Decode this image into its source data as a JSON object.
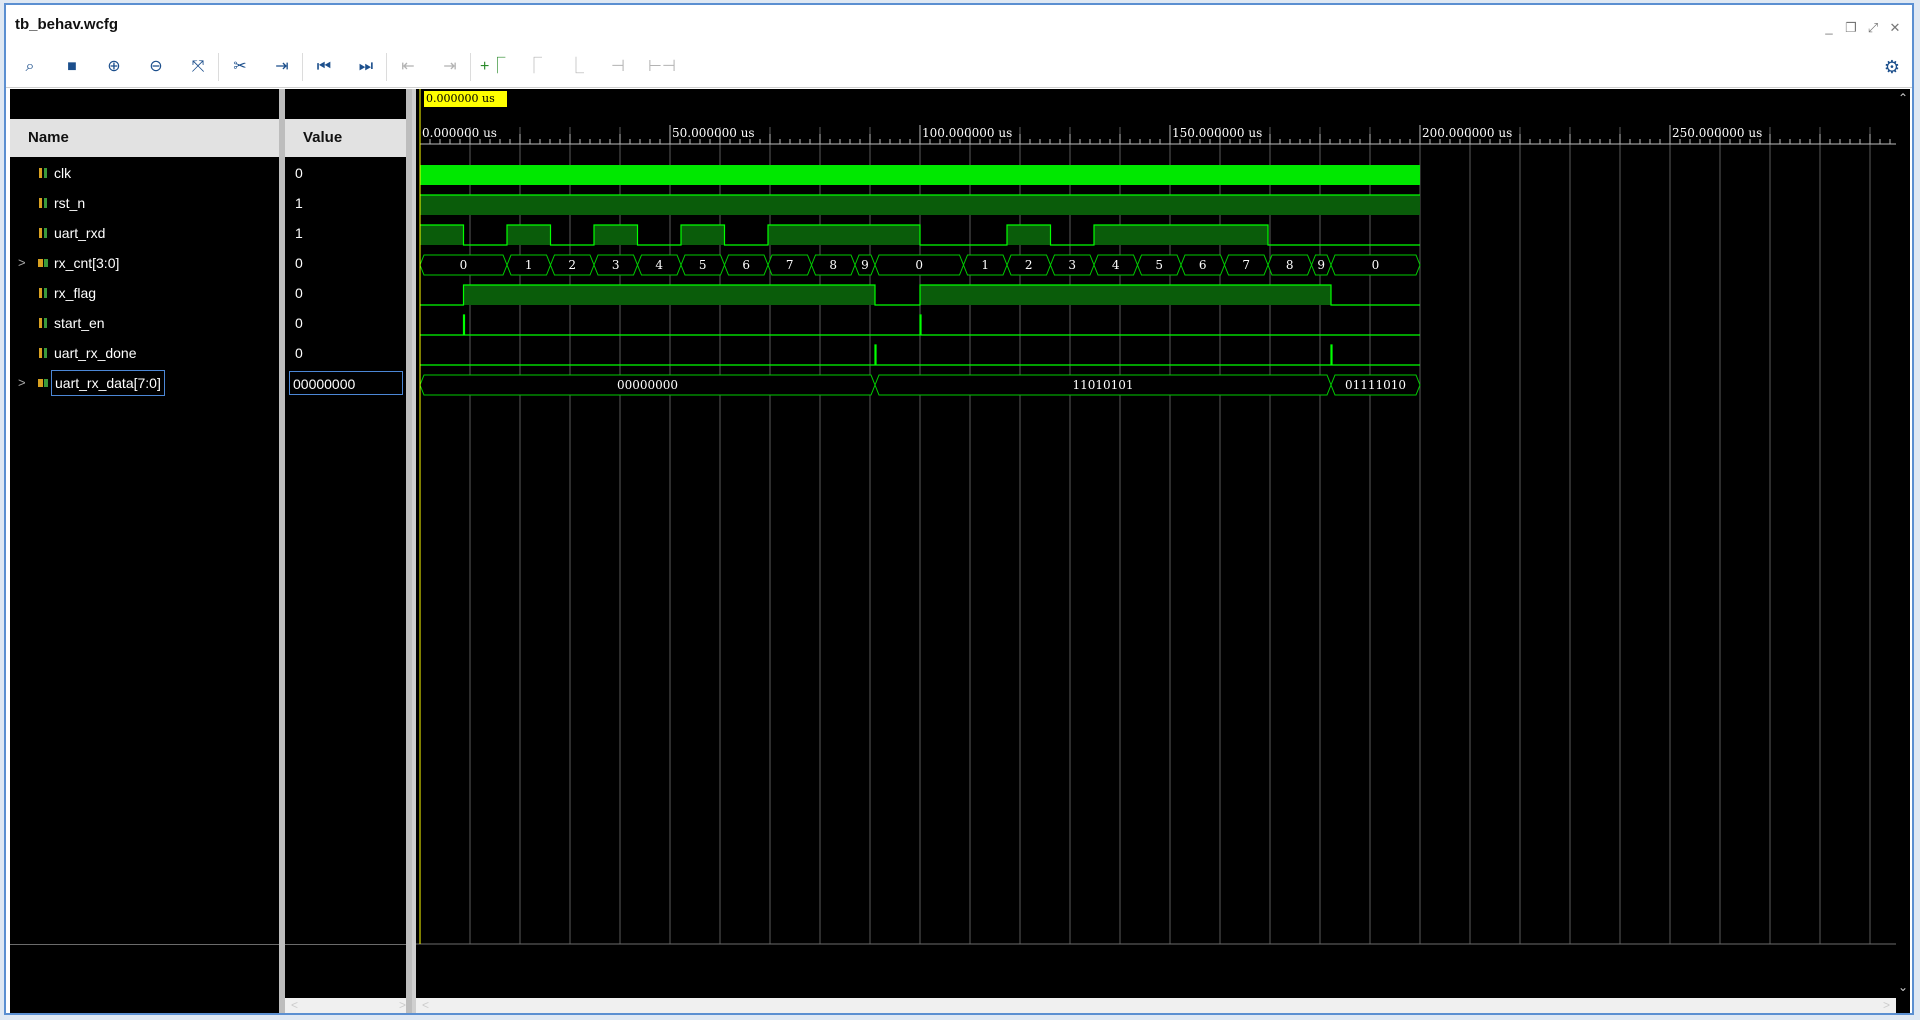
{
  "window": {
    "title": "tb_behav.wcfg",
    "controls": [
      "minimize-icon",
      "restore-icon",
      "float-icon",
      "close-icon"
    ]
  },
  "toolbar": {
    "buttons": [
      {
        "name": "search",
        "icon": "search-icon",
        "enabled": true
      },
      {
        "name": "save",
        "icon": "save-icon",
        "enabled": true
      },
      {
        "name": "zoom-in",
        "icon": "zoom-in-icon",
        "enabled": true
      },
      {
        "name": "zoom-out",
        "icon": "zoom-out-icon",
        "enabled": true
      },
      {
        "name": "zoom-fit",
        "icon": "zoom-fit-icon",
        "enabled": true
      },
      {
        "name": "go-to-cursor",
        "icon": "go-to-cursor-icon",
        "enabled": true
      },
      {
        "name": "add-marker",
        "icon": "add-marker-icon",
        "enabled": true
      },
      {
        "name": "go-to-time-zero",
        "icon": "go-to-start-icon",
        "enabled": true
      },
      {
        "name": "go-to-last-time",
        "icon": "go-to-end-icon",
        "enabled": true
      },
      {
        "name": "previous-transition",
        "icon": "previous-transition-icon",
        "enabled": false
      },
      {
        "name": "next-transition",
        "icon": "next-transition-icon",
        "enabled": false
      },
      {
        "name": "add-marker-2",
        "icon": "add-marker-icon",
        "enabled": true
      },
      {
        "name": "previous-marker",
        "icon": "previous-marker-icon",
        "enabled": false
      },
      {
        "name": "next-marker",
        "icon": "next-marker-icon",
        "enabled": false
      },
      {
        "name": "swap-cursors",
        "icon": "swap-cursors-icon",
        "enabled": false
      },
      {
        "name": "snap-to-transition",
        "icon": "snap-icon",
        "enabled": false
      }
    ],
    "settings_icon": "gear-icon"
  },
  "columns": {
    "name": "Name",
    "value": "Value"
  },
  "signals": [
    {
      "name": "clk",
      "value": "0",
      "kind": "bit",
      "expandable": false
    },
    {
      "name": "rst_n",
      "value": "1",
      "kind": "bit",
      "expandable": false
    },
    {
      "name": "uart_rxd",
      "value": "1",
      "kind": "bit",
      "expandable": false
    },
    {
      "name": "rx_cnt[3:0]",
      "value": "0",
      "kind": "bus",
      "expandable": true
    },
    {
      "name": "rx_flag",
      "value": "0",
      "kind": "bit",
      "expandable": false
    },
    {
      "name": "start_en",
      "value": "0",
      "kind": "bit",
      "expandable": false
    },
    {
      "name": "uart_rx_done",
      "value": "0",
      "kind": "bit",
      "expandable": false
    },
    {
      "name": "uart_rx_data[7:0]",
      "value": "00000000",
      "kind": "bus",
      "expandable": true,
      "selected": true
    }
  ],
  "expand_glyph": ">",
  "cursor": {
    "label": "0.000000 us",
    "time": 0
  },
  "timeline": {
    "unit": "us",
    "tick_labels": [
      "0.000000 us",
      "50.000000 us",
      "100.000000 us",
      "150.000000 us",
      "200.000000 us",
      "250.000000 us"
    ],
    "tick_values": [
      0,
      50,
      100,
      150,
      200,
      250
    ],
    "major_step": 10,
    "minor_step": 2,
    "sim_end": 200,
    "view_end": 296
  },
  "waveforms": {
    "clk": {
      "type": "clock"
    },
    "rst_n": {
      "type": "bit",
      "transitions": [
        [
          0,
          1
        ]
      ]
    },
    "uart_rxd": {
      "type": "bit",
      "transitions": [
        [
          0,
          1
        ],
        [
          8.7,
          0
        ],
        [
          17.4,
          1
        ],
        [
          26.1,
          0
        ],
        [
          34.8,
          1
        ],
        [
          43.5,
          0
        ],
        [
          52.2,
          1
        ],
        [
          60.9,
          0
        ],
        [
          69.6,
          1
        ],
        [
          100,
          0
        ],
        [
          117.4,
          1
        ],
        [
          126.1,
          0
        ],
        [
          134.8,
          1
        ],
        [
          169.6,
          0
        ],
        [
          200,
          0
        ]
      ]
    },
    "rx_cnt": {
      "type": "bus",
      "segments": [
        {
          "t0": 0,
          "t1": 17.4,
          "label": "0"
        },
        {
          "t0": 17.4,
          "t1": 26.1,
          "label": "1"
        },
        {
          "t0": 26.1,
          "t1": 34.8,
          "label": "2"
        },
        {
          "t0": 34.8,
          "t1": 43.5,
          "label": "3"
        },
        {
          "t0": 43.5,
          "t1": 52.2,
          "label": "4"
        },
        {
          "t0": 52.2,
          "t1": 60.9,
          "label": "5"
        },
        {
          "t0": 60.9,
          "t1": 69.6,
          "label": "6"
        },
        {
          "t0": 69.6,
          "t1": 78.3,
          "label": "7"
        },
        {
          "t0": 78.3,
          "t1": 87.0,
          "label": "8"
        },
        {
          "t0": 87.0,
          "t1": 91.0,
          "label": "9"
        },
        {
          "t0": 91.0,
          "t1": 108.7,
          "label": "0"
        },
        {
          "t0": 108.7,
          "t1": 117.4,
          "label": "1"
        },
        {
          "t0": 117.4,
          "t1": 126.1,
          "label": "2"
        },
        {
          "t0": 126.1,
          "t1": 134.8,
          "label": "3"
        },
        {
          "t0": 134.8,
          "t1": 143.5,
          "label": "4"
        },
        {
          "t0": 143.5,
          "t1": 152.2,
          "label": "5"
        },
        {
          "t0": 152.2,
          "t1": 160.9,
          "label": "6"
        },
        {
          "t0": 160.9,
          "t1": 169.6,
          "label": "7"
        },
        {
          "t0": 169.6,
          "t1": 178.3,
          "label": "8"
        },
        {
          "t0": 178.3,
          "t1": 182.2,
          "label": "9"
        },
        {
          "t0": 182.2,
          "t1": 200,
          "label": "0"
        }
      ]
    },
    "rx_flag": {
      "type": "bit",
      "transitions": [
        [
          0,
          0
        ],
        [
          8.7,
          1
        ],
        [
          91.0,
          0
        ],
        [
          100,
          1
        ],
        [
          182.2,
          0
        ]
      ]
    },
    "start_en": {
      "type": "bit",
      "transitions": [
        [
          0,
          0
        ],
        [
          8.7,
          1
        ],
        [
          8.9,
          0
        ],
        [
          100,
          1
        ],
        [
          100.2,
          0
        ]
      ]
    },
    "uart_rx_done": {
      "type": "bit",
      "transitions": [
        [
          0,
          0
        ],
        [
          91.0,
          1
        ],
        [
          91.2,
          0
        ],
        [
          182.2,
          1
        ],
        [
          182.4,
          0
        ]
      ]
    },
    "uart_rx_data": {
      "type": "bus",
      "segments": [
        {
          "t0": 0,
          "t1": 91.0,
          "label": "00000000"
        },
        {
          "t0": 91.0,
          "t1": 182.2,
          "label": "11010101"
        },
        {
          "t0": 182.2,
          "t1": 200,
          "label": "01111010"
        }
      ]
    }
  },
  "colors": {
    "wave": "#00ff00",
    "wave_fill": "#0a5c0a",
    "clock_fill": "#00e800",
    "bus": "#00cc00",
    "grid": "#5a5a5a",
    "cursor": "#ffff00",
    "background": "#000000"
  }
}
